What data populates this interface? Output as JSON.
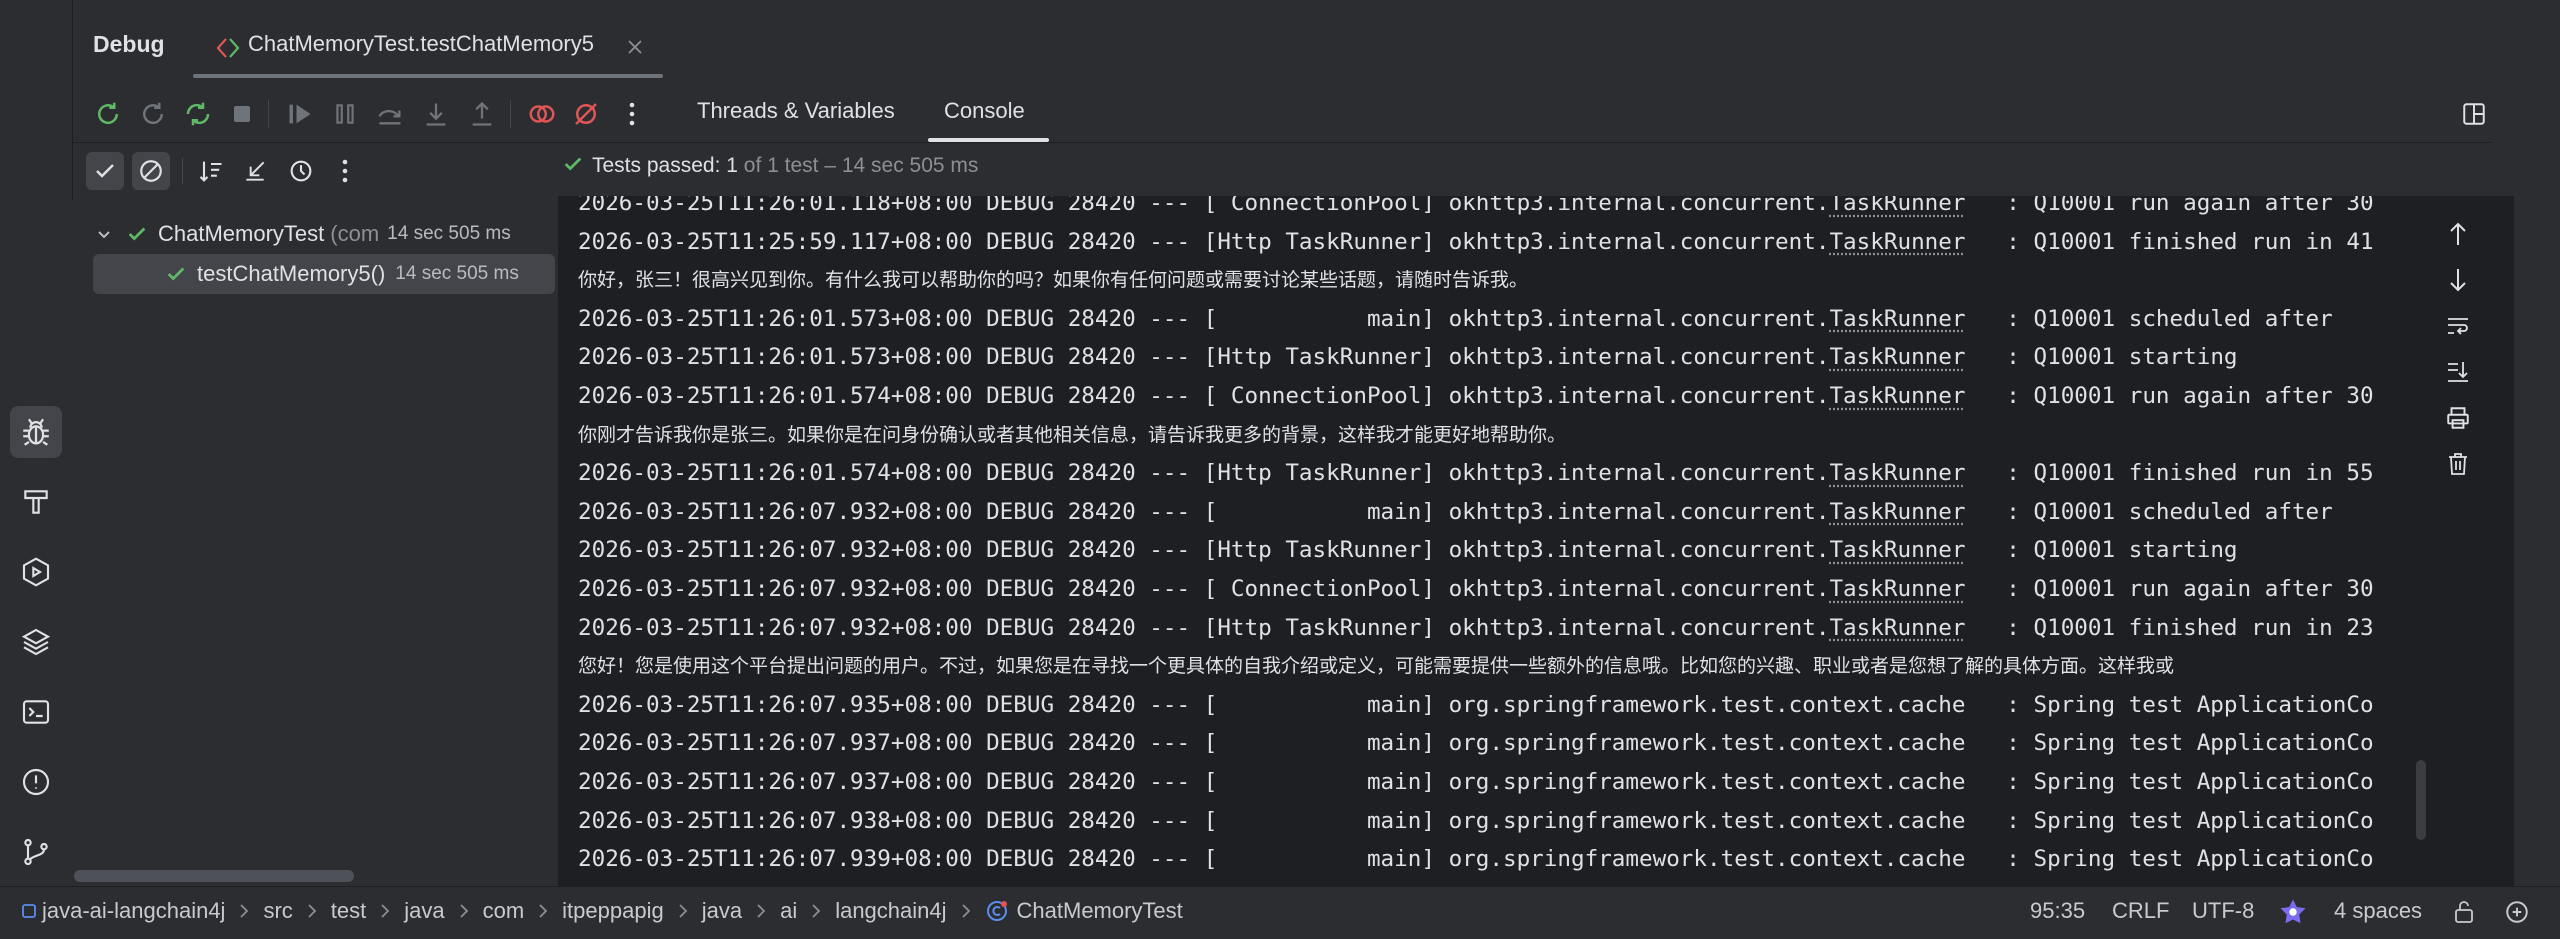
{
  "window": {
    "tool_title": "Debug",
    "session_tab_label": "ChatMemoryTest.testChatMemory5"
  },
  "toolbar": {
    "tabs": [
      {
        "label": "Threads & Variables"
      },
      {
        "label": "Console"
      }
    ],
    "active_tab": "Console"
  },
  "test_status": {
    "prefix": "Tests passed:",
    "passed": "1",
    "suffix": "of 1 test – 14 sec 505 ms"
  },
  "tree": {
    "root": {
      "name": "ChatMemoryTest",
      "hint": "(com",
      "time": "14 sec 505 ms"
    },
    "child": {
      "name": "testChatMemory5()",
      "time": "14 sec 505 ms"
    }
  },
  "console": {
    "lines": [
      {
        "type": "log",
        "pre": "2026-03-25T11:26:01.118+08:00 DEBUG 28420 --- [ ConnectionPool] okhttp3.internal.concurrent.",
        "cls": "TaskRunner",
        "post": "   : Q10001 run again after 30"
      },
      {
        "type": "log",
        "pre": "2026-03-25T11:25:59.117+08:00 DEBUG 28420 --- [Http TaskRunner] okhttp3.internal.concurrent.",
        "cls": "TaskRunner",
        "post": "   : Q10001 finished run in 41"
      },
      {
        "type": "cn",
        "text": "你好，张三！很高兴见到你。有什么我可以帮助你的吗？如果你有任何问题或需要讨论某些话题，请随时告诉我。"
      },
      {
        "type": "log",
        "pre": "2026-03-25T11:26:01.573+08:00 DEBUG 28420 --- [           main] okhttp3.internal.concurrent.",
        "cls": "TaskRunner",
        "post": "   : Q10001 scheduled after"
      },
      {
        "type": "log",
        "pre": "2026-03-25T11:26:01.573+08:00 DEBUG 28420 --- [Http TaskRunner] okhttp3.internal.concurrent.",
        "cls": "TaskRunner",
        "post": "   : Q10001 starting"
      },
      {
        "type": "log",
        "pre": "2026-03-25T11:26:01.574+08:00 DEBUG 28420 --- [ ConnectionPool] okhttp3.internal.concurrent.",
        "cls": "TaskRunner",
        "post": "   : Q10001 run again after 30"
      },
      {
        "type": "cn",
        "text": "你刚才告诉我你是张三。如果你是在问身份确认或者其他相关信息，请告诉我更多的背景，这样我才能更好地帮助你。"
      },
      {
        "type": "log",
        "pre": "2026-03-25T11:26:01.574+08:00 DEBUG 28420 --- [Http TaskRunner] okhttp3.internal.concurrent.",
        "cls": "TaskRunner",
        "post": "   : Q10001 finished run in 55"
      },
      {
        "type": "log",
        "pre": "2026-03-25T11:26:07.932+08:00 DEBUG 28420 --- [           main] okhttp3.internal.concurrent.",
        "cls": "TaskRunner",
        "post": "   : Q10001 scheduled after"
      },
      {
        "type": "log",
        "pre": "2026-03-25T11:26:07.932+08:00 DEBUG 28420 --- [Http TaskRunner] okhttp3.internal.concurrent.",
        "cls": "TaskRunner",
        "post": "   : Q10001 starting"
      },
      {
        "type": "log",
        "pre": "2026-03-25T11:26:07.932+08:00 DEBUG 28420 --- [ ConnectionPool] okhttp3.internal.concurrent.",
        "cls": "TaskRunner",
        "post": "   : Q10001 run again after 30"
      },
      {
        "type": "log",
        "pre": "2026-03-25T11:26:07.932+08:00 DEBUG 28420 --- [Http TaskRunner] okhttp3.internal.concurrent.",
        "cls": "TaskRunner",
        "post": "   : Q10001 finished run in 23"
      },
      {
        "type": "cn",
        "text": "您好！您是使用这个平台提出问题的用户。不过，如果您是在寻找一个更具体的自我介绍或定义，可能需要提供一些额外的信息哦。比如您的兴趣、职业或者是您想了解的具体方面。这样我或"
      },
      {
        "type": "log",
        "pre": "2026-03-25T11:26:07.935+08:00 DEBUG 28420 --- [           main] org.springframework.test.context.cache   : Spring test ApplicationCo",
        "cls": "",
        "post": ""
      },
      {
        "type": "log",
        "pre": "2026-03-25T11:26:07.937+08:00 DEBUG 28420 --- [           main] org.springframework.test.context.cache   : Spring test ApplicationCo",
        "cls": "",
        "post": ""
      },
      {
        "type": "log",
        "pre": "2026-03-25T11:26:07.937+08:00 DEBUG 28420 --- [           main] org.springframework.test.context.cache   : Spring test ApplicationCo",
        "cls": "",
        "post": ""
      },
      {
        "type": "log",
        "pre": "2026-03-25T11:26:07.938+08:00 DEBUG 28420 --- [           main] org.springframework.test.context.cache   : Spring test ApplicationCo",
        "cls": "",
        "post": ""
      },
      {
        "type": "log",
        "pre": "2026-03-25T11:26:07.939+08:00 DEBUG 28420 --- [           main] org.springframework.test.context.cache   : Spring test ApplicationCo",
        "cls": "",
        "post": ""
      }
    ]
  },
  "breadcrumbs": [
    {
      "label": "java-ai-langchain4j",
      "icon": "module-icon"
    },
    {
      "label": "src"
    },
    {
      "label": "test"
    },
    {
      "label": "java"
    },
    {
      "label": "com"
    },
    {
      "label": "itpeppapig"
    },
    {
      "label": "java"
    },
    {
      "label": "ai"
    },
    {
      "label": "langchain4j"
    },
    {
      "label": "ChatMemoryTest",
      "icon": "class-icon"
    }
  ],
  "status": {
    "position": "95:35",
    "line_sep": "CRLF",
    "encoding": "UTF-8",
    "indent": "4 spaces"
  },
  "icons": {
    "left_stripe": [
      "bug-icon",
      "build-icon",
      "services-icon",
      "layers-icon",
      "terminal-icon",
      "problems-icon",
      "git-icon"
    ],
    "right_actions": [
      "arrow-up-icon",
      "arrow-down-icon",
      "soft-wrap-icon",
      "scroll-to-end-icon",
      "print-icon",
      "trash-icon"
    ]
  },
  "colors": {
    "pass_green": "#5fb865",
    "console_bg": "#1e1f22",
    "panel_bg": "#2b2d30",
    "rerun_red": "#e05555"
  }
}
